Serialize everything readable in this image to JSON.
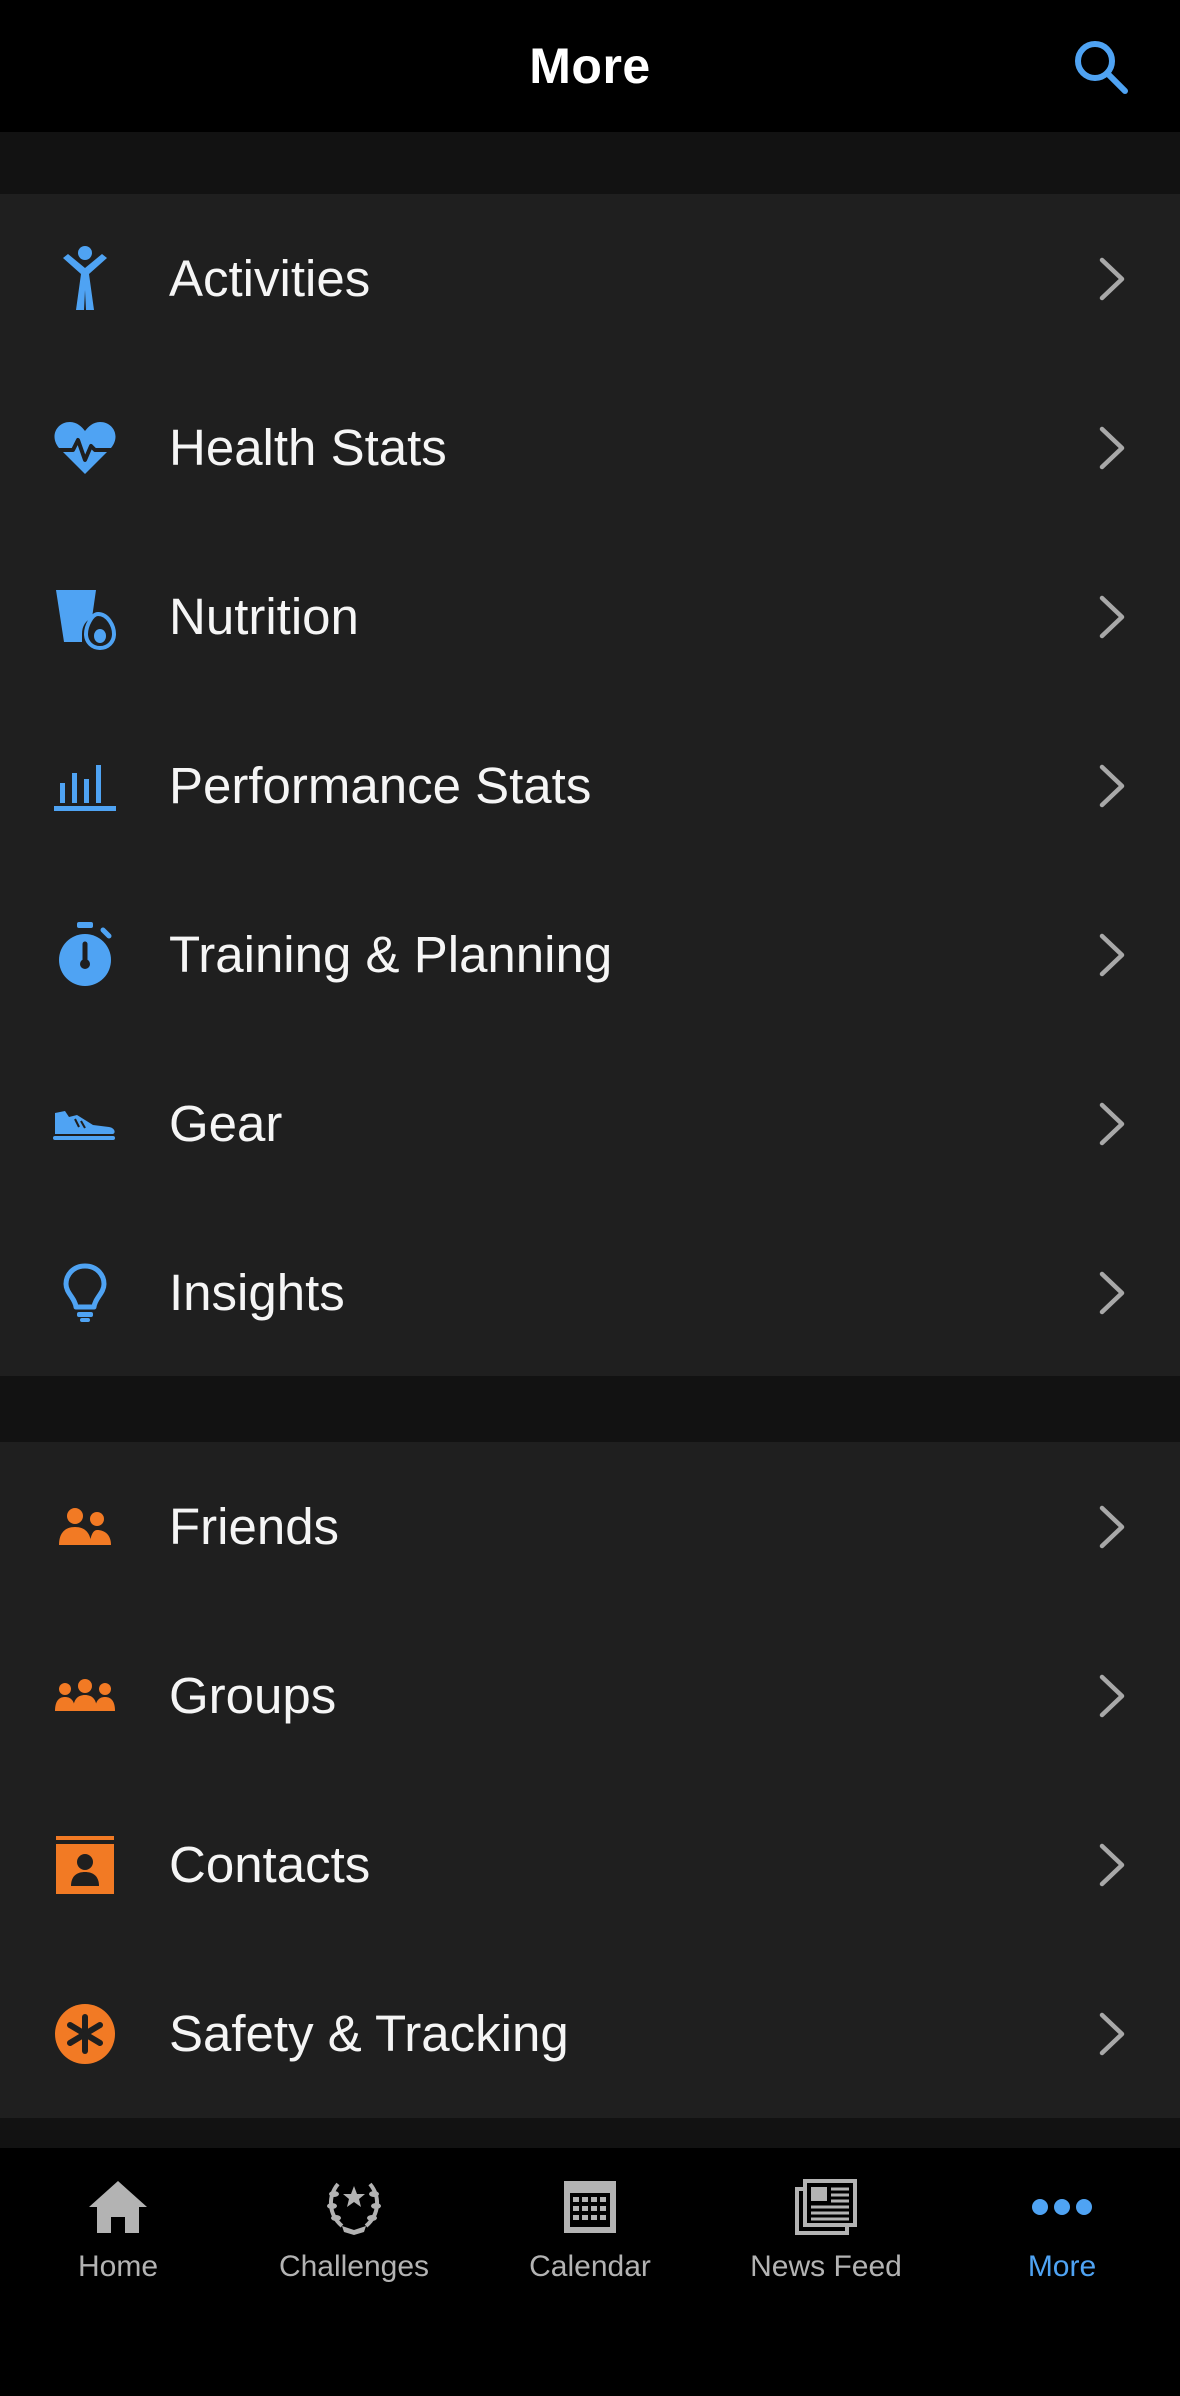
{
  "header": {
    "title": "More",
    "search_icon": "search-icon"
  },
  "colors": {
    "accent_blue": "#4fa3f3",
    "accent_orange": "#f27a24",
    "row_bg": "#1f1f1f",
    "chevron": "#a8a8a8",
    "tab_inactive": "#b3b3b3"
  },
  "section1": {
    "items": [
      {
        "label": "Activities",
        "icon": "activities-person-icon"
      },
      {
        "label": "Health Stats",
        "icon": "heart-pulse-icon"
      },
      {
        "label": "Nutrition",
        "icon": "nutrition-cup-avocado-icon"
      },
      {
        "label": "Performance Stats",
        "icon": "bar-chart-icon"
      },
      {
        "label": "Training & Planning",
        "icon": "stopwatch-icon"
      },
      {
        "label": "Gear",
        "icon": "shoe-icon"
      },
      {
        "label": "Insights",
        "icon": "lightbulb-icon"
      }
    ]
  },
  "section2": {
    "items": [
      {
        "label": "Friends",
        "icon": "friends-icon"
      },
      {
        "label": "Groups",
        "icon": "groups-icon"
      },
      {
        "label": "Contacts",
        "icon": "contacts-card-icon"
      },
      {
        "label": "Safety & Tracking",
        "icon": "safety-asterisk-icon"
      }
    ]
  },
  "tabbar": {
    "tabs": [
      {
        "label": "Home",
        "icon": "home-icon"
      },
      {
        "label": "Challenges",
        "icon": "laurel-icon"
      },
      {
        "label": "Calendar",
        "icon": "calendar-icon"
      },
      {
        "label": "News Feed",
        "icon": "newspaper-icon"
      },
      {
        "label": "More",
        "icon": "more-dots-icon",
        "active": true
      }
    ]
  }
}
